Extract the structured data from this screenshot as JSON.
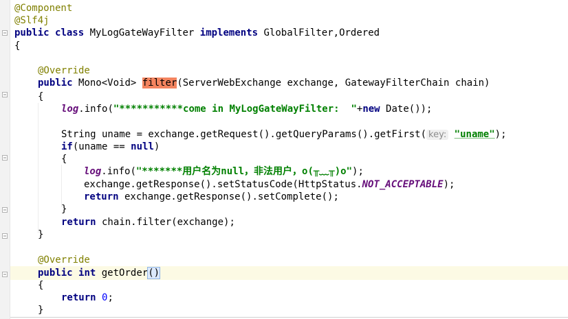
{
  "code": {
    "ann_component": "@Component",
    "ann_slf4j": "@Slf4j",
    "class_decl": {
      "kw_public": "public",
      "kw_class": "class",
      "name": "MyLogGateWayFilter",
      "kw_implements": "implements",
      "interfaces": "GlobalFilter,Ordered"
    },
    "open_brace": "{",
    "override1": "@Override",
    "method1": {
      "kw_public": "public",
      "return_type": "Mono<Void>",
      "name": "filter",
      "params": "(ServerWebExchange exchange, GatewayFilterChain chain)"
    },
    "body1_open": "{",
    "log_info_1": {
      "field": "log",
      "call": ".info(",
      "string": "\"***********come in MyLogGateWayFilter:  \"",
      "plus": "+",
      "kw_new": "new",
      "rest": " Date());"
    },
    "uname_line": {
      "decl": "String uname = exchange.getRequest().getQueryParams().getFirst(",
      "hint": "key:",
      "string": "\"uname\"",
      "close": ");"
    },
    "if_line": {
      "kw_if": "if",
      "cond_open": "(uname == ",
      "kw_null": "null",
      "cond_close": ")"
    },
    "if_open": "{",
    "log_info_2": {
      "field": "log",
      "call": ".info(",
      "string": "\"*******用户名为null，非法用户，o(╥﹏╥)o\"",
      "close": ");"
    },
    "status_line": {
      "start": "exchange.getResponse().setStatusCode(HttpStatus.",
      "constant": "NOT_ACCEPTABLE",
      "close": ");"
    },
    "return_complete": {
      "kw_return": "return",
      "rest": " exchange.getResponse().setComplete();"
    },
    "if_close": "}",
    "return_chain": {
      "kw_return": "return",
      "rest": " chain.filter(exchange);"
    },
    "body1_close": "}",
    "override2": "@Override",
    "method2": {
      "kw_public": "public",
      "kw_int": "int",
      "name": "getOrder",
      "parens": "()"
    },
    "body2_open": "{",
    "return_zero": {
      "kw_return": "return",
      "value": "0",
      "semi": ";"
    },
    "body2_close": "}"
  },
  "colors": {
    "keyword": "#000080",
    "annotation": "#808000",
    "string": "#008000",
    "static_field": "#660e7a",
    "number": "#0000ff",
    "search_highlight": "#f4845f",
    "caret_row": "#fcfae4"
  }
}
